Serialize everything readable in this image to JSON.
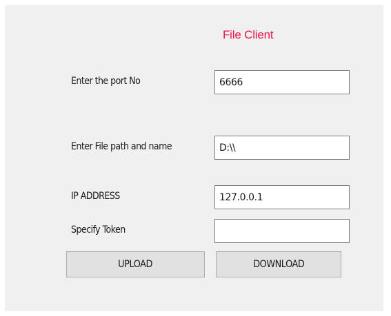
{
  "form": {
    "title": "File Client",
    "port": {
      "label": "Enter the port No",
      "value": "6666"
    },
    "path": {
      "label": "Enter File path and name",
      "value": "D:\\\\"
    },
    "ip": {
      "label": "IP ADDRESS",
      "value": "127.0.0.1"
    },
    "token": {
      "label": "Specify Token",
      "value": ""
    },
    "upload_label": "UPLOAD",
    "download_label": "DOWNLOAD"
  },
  "colors": {
    "title": "#e8174a",
    "panel_background": "#f0f0f0",
    "button_background": "#e1e1e1"
  }
}
